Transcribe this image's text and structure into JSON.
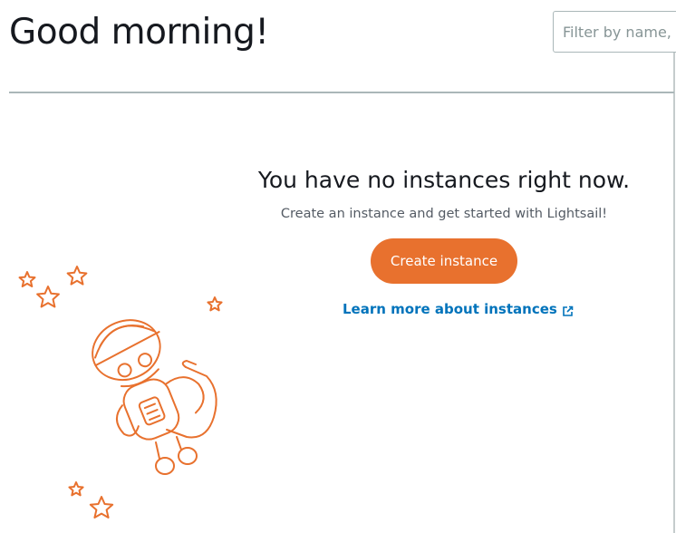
{
  "header": {
    "greeting": "Good morning!",
    "filter_placeholder": "Filter by name, location, tag, or type"
  },
  "empty_state": {
    "title": "You have no instances right now.",
    "subtitle": "Create an instance and get started with Lightsail!",
    "create_button_label": "Create instance",
    "learn_more_label": "Learn more about instances"
  },
  "colors": {
    "accent": "#e8712e",
    "link": "#0073bb",
    "illustration": "#e8712e"
  },
  "icons": {
    "external_link": "external-link-icon",
    "illustration": "robot-astronaut-illustration"
  }
}
